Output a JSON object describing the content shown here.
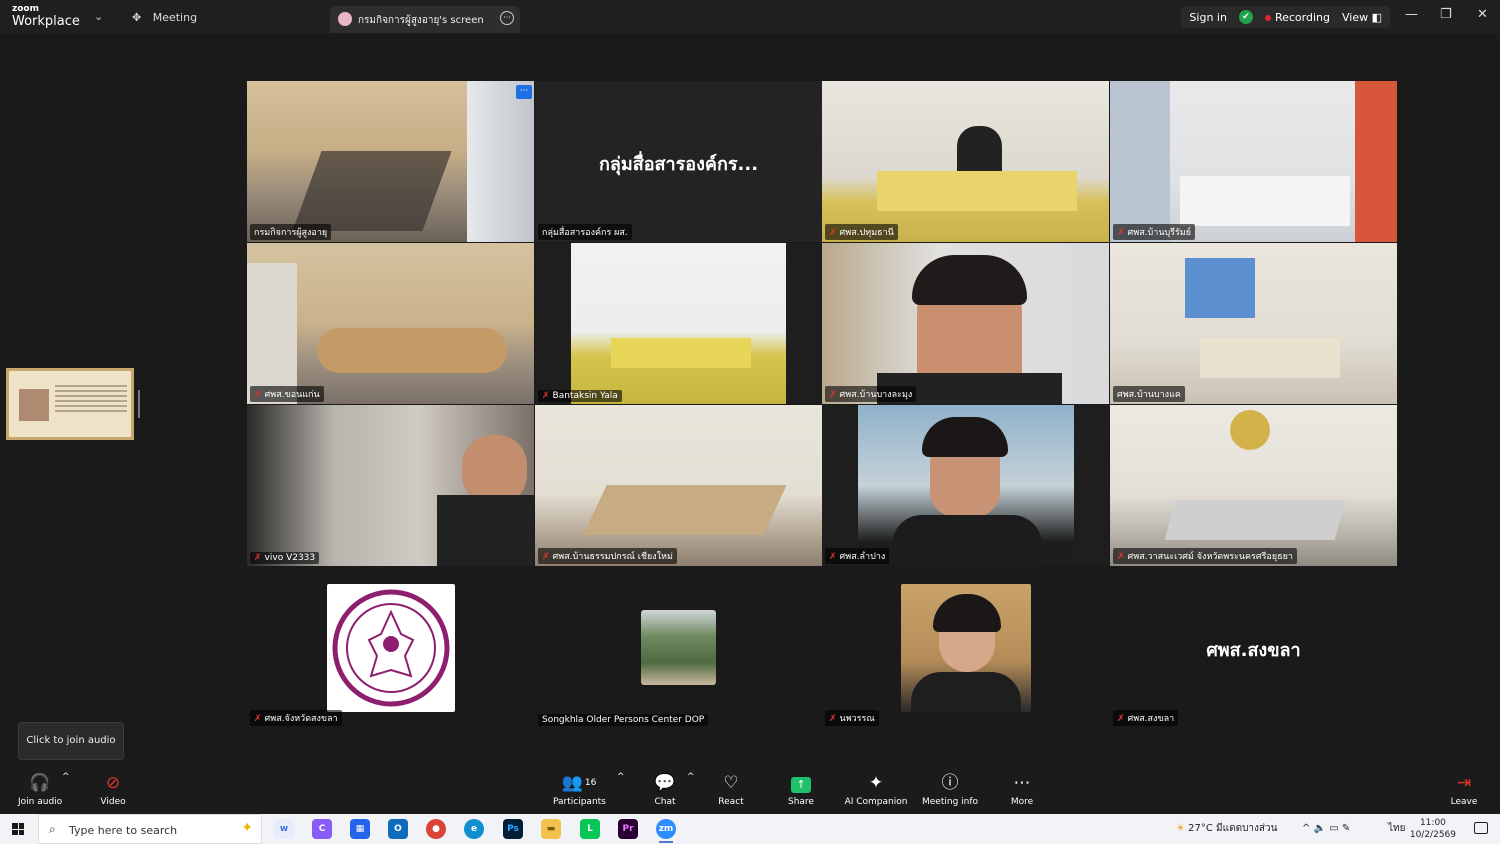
{
  "app": {
    "brand_small": "zoom",
    "brand_large": "Workplace",
    "menu_chevron": "⌄",
    "meeting_label": "Meeting",
    "meeting_icon": "✥"
  },
  "share_tab": {
    "label": "กรมกิจการผู้สูงอายุ's screen",
    "more": "···"
  },
  "top_right": {
    "sign_in": "Sign in",
    "shield": "✔",
    "recording": "Recording",
    "view": "View",
    "view_icon": "◧"
  },
  "window_controls": {
    "minimize": "—",
    "maximize": "❐",
    "close": "✕"
  },
  "tiles": [
    {
      "name": "กรมกิจการผู้สูงอายุ",
      "muted": false,
      "video": true,
      "more": "···"
    },
    {
      "name": "กลุ่มสื่อสารองค์กร ผส.",
      "muted": false,
      "video": false,
      "display": "กลุ่มสื่อสารองค์กร..."
    },
    {
      "name": "ศพส.ปทุมธานี",
      "muted": true,
      "video": true
    },
    {
      "name": "ศพส.บ้านบุรีรัมย์",
      "muted": true,
      "video": true
    },
    {
      "name": "ศพส.ขอนแก่น",
      "muted": true,
      "video": true
    },
    {
      "name": "Bantaksin Yala",
      "muted": true,
      "video": true
    },
    {
      "name": "ศพส.บ้านบางละมุง",
      "muted": true,
      "video": true
    },
    {
      "name": "ศพส.บ้านบางแค",
      "muted": false,
      "video": true
    },
    {
      "name": "vivo V2333",
      "muted": true,
      "video": true
    },
    {
      "name": "ศพส.บ้านธรรมปกรณ์ เชียงใหม่",
      "muted": true,
      "video": true
    },
    {
      "name": "ศพส.ลำปาง",
      "muted": true,
      "video": true
    },
    {
      "name": "ศพส.วาสนะเวศม์ จังหวัดพระนครศรีอยุธยา",
      "muted": true,
      "video": true
    }
  ],
  "bottom_tiles": [
    {
      "name": "ศพส.จังหวัดสงขลา",
      "muted": true
    },
    {
      "name": "Songkhla Older Persons Center DOP",
      "muted": false
    },
    {
      "name": "นพวรรณ",
      "muted": true
    },
    {
      "name": "ศพส.สงขลา",
      "muted": true,
      "display": "ศพส.สงขลา"
    }
  ],
  "mic_off_glyph": "✗",
  "tooltip": "Click to join audio",
  "toolbar": {
    "join_audio": "Join audio",
    "video": "Video",
    "participants": "Participants",
    "participants_count": "16",
    "chat": "Chat",
    "react": "React",
    "share": "Share",
    "ai_companion": "AI Companion",
    "meeting_info": "Meeting info",
    "more": "More",
    "leave": "Leave",
    "caret": "^"
  },
  "taskbar": {
    "search_placeholder": "Type here to search",
    "weather": "27°C  มีแดดบางส่วน",
    "tray_icons": "^  🔈  ▭  ✎",
    "language": "ไทย",
    "time": "11:00",
    "date": "10/2/2569",
    "apps": [
      "w",
      "C",
      "▦",
      "O",
      "●",
      "e",
      "Ps",
      "▬",
      "L",
      "Pr",
      "zm"
    ]
  },
  "colors": {
    "accent_green": "#23d18b",
    "share_green": "#1fc16b",
    "record_red": "#e0262d",
    "thumb_border": "#c7a56b"
  }
}
